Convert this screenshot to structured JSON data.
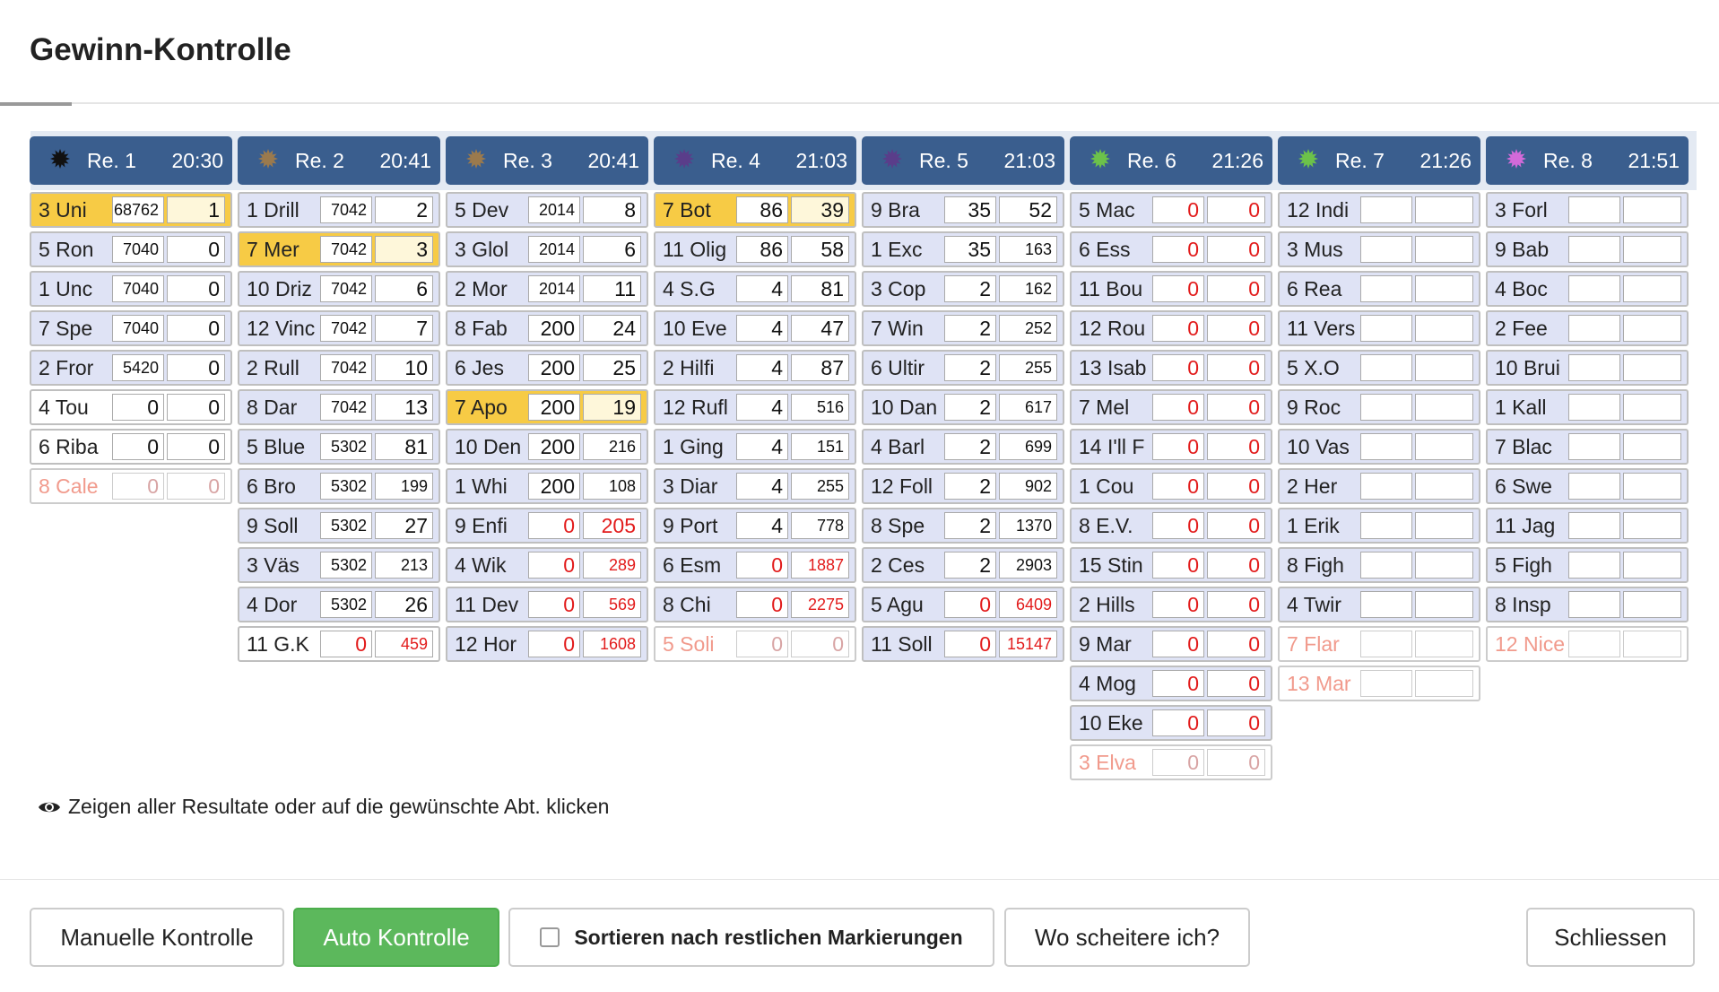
{
  "title": "Gewinn-Kontrolle",
  "races": [
    {
      "name": "Re. 1",
      "time": "20:30",
      "color": "#111111",
      "rows": [
        {
          "name": "3 Uni",
          "v1": "68762",
          "v2": "1",
          "state": "hl"
        },
        {
          "name": "5 Ron",
          "v1": "7040",
          "v2": "0"
        },
        {
          "name": "1 Unc",
          "v1": "7040",
          "v2": "0"
        },
        {
          "name": "7 Spe",
          "v1": "7040",
          "v2": "0"
        },
        {
          "name": "2 Fror",
          "v1": "5420",
          "v2": "0"
        },
        {
          "name": "4 Tou",
          "v1": "0",
          "v2": "0",
          "state": "plain"
        },
        {
          "name": "6 Riba",
          "v1": "0",
          "v2": "0",
          "state": "plain"
        },
        {
          "name": "8 Cale",
          "v1": "0",
          "v2": "0",
          "state": "dim"
        }
      ]
    },
    {
      "name": "Re. 2",
      "time": "20:41",
      "color": "#9b7a4d",
      "rows": [
        {
          "name": "1 Drill",
          "v1": "7042",
          "v2": "2"
        },
        {
          "name": "7 Mer",
          "v1": "7042",
          "v2": "3",
          "state": "hl"
        },
        {
          "name": "10 Driz",
          "v1": "7042",
          "v2": "6"
        },
        {
          "name": "12 Vinc",
          "v1": "7042",
          "v2": "7"
        },
        {
          "name": "2 Rull",
          "v1": "7042",
          "v2": "10"
        },
        {
          "name": "8 Dar",
          "v1": "7042",
          "v2": "13"
        },
        {
          "name": "5 Blue",
          "v1": "5302",
          "v2": "81"
        },
        {
          "name": "6 Bro",
          "v1": "5302",
          "v2": "199"
        },
        {
          "name": "9 Soll",
          "v1": "5302",
          "v2": "27"
        },
        {
          "name": "3 Väs",
          "v1": "5302",
          "v2": "213"
        },
        {
          "name": "4 Dor",
          "v1": "5302",
          "v2": "26"
        },
        {
          "name": "11 G.K",
          "v1": "0",
          "v2": "459",
          "state": "plain",
          "red": true
        }
      ]
    },
    {
      "name": "Re. 3",
      "time": "20:41",
      "color": "#9b7a4d",
      "rows": [
        {
          "name": "5 Dev",
          "v1": "2014",
          "v2": "8"
        },
        {
          "name": "3 Glol",
          "v1": "2014",
          "v2": "6"
        },
        {
          "name": "2 Mor",
          "v1": "2014",
          "v2": "11"
        },
        {
          "name": "8 Fab",
          "v1": "200",
          "v2": "24"
        },
        {
          "name": "6 Jes",
          "v1": "200",
          "v2": "25"
        },
        {
          "name": "7 Apo",
          "v1": "200",
          "v2": "19",
          "state": "hl"
        },
        {
          "name": "10 Den",
          "v1": "200",
          "v2": "216"
        },
        {
          "name": "1 Whi",
          "v1": "200",
          "v2": "108"
        },
        {
          "name": "9 Enfi",
          "v1": "0",
          "v2": "205",
          "red": true
        },
        {
          "name": "4 Wik",
          "v1": "0",
          "v2": "289",
          "red": true
        },
        {
          "name": "11 Dev",
          "v1": "0",
          "v2": "569",
          "red": true
        },
        {
          "name": "12 Hor",
          "v1": "0",
          "v2": "1608",
          "red": true
        }
      ]
    },
    {
      "name": "Re. 4",
      "time": "21:03",
      "color": "#5a3d8a",
      "rows": [
        {
          "name": "7 Bot",
          "v1": "86",
          "v2": "39",
          "state": "hl"
        },
        {
          "name": "11 Olig",
          "v1": "86",
          "v2": "58"
        },
        {
          "name": "4 S.G",
          "v1": "4",
          "v2": "81"
        },
        {
          "name": "10 Eve",
          "v1": "4",
          "v2": "47"
        },
        {
          "name": "2 Hilfi",
          "v1": "4",
          "v2": "87"
        },
        {
          "name": "12 Rufl",
          "v1": "4",
          "v2": "516"
        },
        {
          "name": "1 Ging",
          "v1": "4",
          "v2": "151"
        },
        {
          "name": "3 Diar",
          "v1": "4",
          "v2": "255"
        },
        {
          "name": "9 Port",
          "v1": "4",
          "v2": "778"
        },
        {
          "name": "6 Esm",
          "v1": "0",
          "v2": "1887",
          "red": true
        },
        {
          "name": "8 Chi",
          "v1": "0",
          "v2": "2275",
          "red": true
        },
        {
          "name": "5 Soli",
          "v1": "0",
          "v2": "0",
          "state": "dim"
        }
      ]
    },
    {
      "name": "Re. 5",
      "time": "21:03",
      "color": "#5a3d8a",
      "rows": [
        {
          "name": "9 Bra",
          "v1": "35",
          "v2": "52"
        },
        {
          "name": "1 Exc",
          "v1": "35",
          "v2": "163"
        },
        {
          "name": "3 Cop",
          "v1": "2",
          "v2": "162"
        },
        {
          "name": "7 Win",
          "v1": "2",
          "v2": "252"
        },
        {
          "name": "6 Ultir",
          "v1": "2",
          "v2": "255"
        },
        {
          "name": "10 Dan",
          "v1": "2",
          "v2": "617"
        },
        {
          "name": "4 Barl",
          "v1": "2",
          "v2": "699"
        },
        {
          "name": "12 Foll",
          "v1": "2",
          "v2": "902"
        },
        {
          "name": "8 Spe",
          "v1": "2",
          "v2": "1370"
        },
        {
          "name": "2 Ces",
          "v1": "2",
          "v2": "2903"
        },
        {
          "name": "5 Agu",
          "v1": "0",
          "v2": "6409",
          "red": true
        },
        {
          "name": "11 Soll",
          "v1": "0",
          "v2": "15147",
          "red": true
        }
      ]
    },
    {
      "name": "Re. 6",
      "time": "21:26",
      "color": "#6cc24a",
      "rows": [
        {
          "name": "5 Mac",
          "v1": "0",
          "v2": "0",
          "red": true
        },
        {
          "name": "6 Ess",
          "v1": "0",
          "v2": "0",
          "red": true
        },
        {
          "name": "11 Bou",
          "v1": "0",
          "v2": "0",
          "red": true
        },
        {
          "name": "12 Rou",
          "v1": "0",
          "v2": "0",
          "red": true
        },
        {
          "name": "13 Isab",
          "v1": "0",
          "v2": "0",
          "red": true
        },
        {
          "name": "7 Mel",
          "v1": "0",
          "v2": "0",
          "red": true
        },
        {
          "name": "14 I'll F",
          "v1": "0",
          "v2": "0",
          "red": true
        },
        {
          "name": "1 Cou",
          "v1": "0",
          "v2": "0",
          "red": true
        },
        {
          "name": "8 E.V.",
          "v1": "0",
          "v2": "0",
          "red": true
        },
        {
          "name": "15 Stin",
          "v1": "0",
          "v2": "0",
          "red": true
        },
        {
          "name": "2 Hills",
          "v1": "0",
          "v2": "0",
          "red": true
        },
        {
          "name": "9 Mar",
          "v1": "0",
          "v2": "0",
          "red": true
        },
        {
          "name": "4 Mog",
          "v1": "0",
          "v2": "0",
          "red": true
        },
        {
          "name": "10 Eke",
          "v1": "0",
          "v2": "0",
          "red": true
        },
        {
          "name": "3 Elva",
          "v1": "0",
          "v2": "0",
          "state": "dim"
        }
      ]
    },
    {
      "name": "Re. 7",
      "time": "21:26",
      "color": "#6cc24a",
      "rows": [
        {
          "name": "12 Indi",
          "v1": "",
          "v2": ""
        },
        {
          "name": "3 Mus",
          "v1": "",
          "v2": ""
        },
        {
          "name": "6 Rea",
          "v1": "",
          "v2": ""
        },
        {
          "name": "11 Vers",
          "v1": "",
          "v2": ""
        },
        {
          "name": "5 X.O",
          "v1": "",
          "v2": ""
        },
        {
          "name": "9 Roc",
          "v1": "",
          "v2": ""
        },
        {
          "name": "10 Vas",
          "v1": "",
          "v2": ""
        },
        {
          "name": "2 Her",
          "v1": "",
          "v2": ""
        },
        {
          "name": "1 Erik",
          "v1": "",
          "v2": ""
        },
        {
          "name": "8 Figh",
          "v1": "",
          "v2": ""
        },
        {
          "name": "4 Twir",
          "v1": "",
          "v2": ""
        },
        {
          "name": "7 Flar",
          "v1": "",
          "v2": "",
          "state": "dim"
        },
        {
          "name": "13 Mar",
          "v1": "",
          "v2": "",
          "state": "dim"
        }
      ]
    },
    {
      "name": "Re. 8",
      "time": "21:51",
      "color": "#d36ad9",
      "rows": [
        {
          "name": "3 Forl",
          "v1": "",
          "v2": ""
        },
        {
          "name": "9 Bab",
          "v1": "",
          "v2": ""
        },
        {
          "name": "4 Boc",
          "v1": "",
          "v2": ""
        },
        {
          "name": "2 Fee",
          "v1": "",
          "v2": ""
        },
        {
          "name": "10 Brui",
          "v1": "",
          "v2": ""
        },
        {
          "name": "1 Kall",
          "v1": "",
          "v2": ""
        },
        {
          "name": "7 Blac",
          "v1": "",
          "v2": ""
        },
        {
          "name": "6 Swe",
          "v1": "",
          "v2": ""
        },
        {
          "name": "11 Jag",
          "v1": "",
          "v2": ""
        },
        {
          "name": "5 Figh",
          "v1": "",
          "v2": ""
        },
        {
          "name": "8 Insp",
          "v1": "",
          "v2": ""
        },
        {
          "name": "12 Nice",
          "v1": "",
          "v2": "",
          "state": "dim"
        }
      ]
    }
  ],
  "hint": "Zeigen aller Resultate oder auf die gewünschte Abt. klicken",
  "buttons": {
    "manual": "Manuelle Kontrolle",
    "auto": "Auto Kontrolle",
    "sort": "Sortieren nach restlichen Markierungen",
    "fail": "Wo scheitere ich?",
    "close": "Schliessen"
  }
}
